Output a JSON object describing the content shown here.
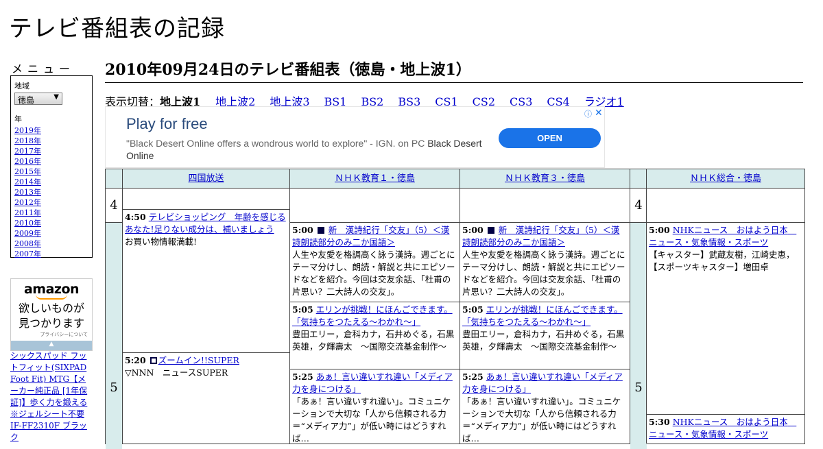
{
  "site_title": "テレビ番組表の記録",
  "sidebar": {
    "menu_title": "メニュー",
    "region_label": "地域",
    "region_value": "徳島",
    "year_label": "年",
    "years": [
      "2019年",
      "2018年",
      "2017年",
      "2016年",
      "2015年",
      "2014年",
      "2013年",
      "2012年",
      "2011年",
      "2010年",
      "2009年",
      "2008年",
      "2007年"
    ],
    "ad": {
      "logo": "amazon",
      "line1": "欲しいものが",
      "line2": "見つかります",
      "privacy": "プライバシーについて"
    },
    "product_link": "シックスパッド フットフィット(SIXPAD Foot Fit) MTG【メーカー純正品 [1年保証]】歩く力を鍛える ※ジェルシート不要 IF-FF2310F ブラック"
  },
  "page_title": "2010年09月24日のテレビ番組表（徳島・地上波1）",
  "switch": {
    "label": "表示切替：",
    "current": "地上波1",
    "links": [
      "地上波2",
      "地上波3",
      "BS1",
      "BS2",
      "BS3",
      "CS1",
      "CS2",
      "CS3",
      "CS4",
      "ラジオ1"
    ]
  },
  "banner": {
    "headline": "Play for free",
    "text": "\"Black Desert Online offers a wondrous world to explore\" - IGN. on PC",
    "brand": "Black Desert Online",
    "cta": "OPEN"
  },
  "channels": [
    "四国放送",
    "ＮＨＫ教育１・徳島",
    "ＮＨＫ教育３・徳島",
    "ＮＨＫ総合・徳島"
  ],
  "hours": [
    "4",
    "5"
  ],
  "programs": {
    "ch1": [
      {
        "time": "4:50",
        "title": "テレビショッピング　年齢を感じるあなた!足りない成分は、補いましょう",
        "desc": "お買い物情報満載!"
      },
      {
        "time": "5:20",
        "title": "ズームイン!!SUPER",
        "desc": "▽NNN　ニュースSUPER"
      }
    ],
    "ch2": [
      {
        "time": "5:00",
        "title": "新　漢詩紀行「交友」（5）＜漢詩朗読部分のみ二か国語＞",
        "desc": "人生や友愛を格調高く詠う漢詩。週ごとにテーマ分けし、朗読・解説と共にエピソードなどを紹介。今回は交友余話、「杜甫の片思い？二大詩人の交友」。"
      },
      {
        "time": "5:05",
        "title": "エリンが挑戦！にほんごできます。「気持ちをつたえる～わかれ～」",
        "desc": "豊田エリー，倉科カナ，石井めぐる，石黒英雄，夕輝壽太　～国際交流基金制作～"
      },
      {
        "time": "5:25",
        "title": "あぁ！言い違いすれ違い「メディア力を身につける」",
        "desc": "「あぁ！言い違いすれ違い」。コミュニケーションで大切な「人から信頼される力＝“メディア力”」が低い時にはどうすれば…"
      }
    ],
    "ch3": [
      {
        "time": "5:00",
        "title": "新　漢詩紀行「交友」（5）＜漢詩朗読部分のみ二か国語＞",
        "desc": "人生や友愛を格調高く詠う漢詩。週ごとにテーマ分けし、朗読・解説と共にエピソードなどを紹介。今回は交友余話、「杜甫の片思い？二大詩人の交友」。"
      },
      {
        "time": "5:05",
        "title": "エリンが挑戦！にほんごできます。「気持ちをつたえる～わかれ～」",
        "desc": "豊田エリー，倉科カナ，石井めぐる，石黒英雄，夕輝壽太　～国際交流基金制作～"
      },
      {
        "time": "5:25",
        "title": "あぁ！言い違いすれ違い「メディア力を身につける」",
        "desc": "「あぁ！言い違いすれ違い」。コミュニケーションで大切な「人から信頼される力＝“メディア力”」が低い時にはどうすれば…"
      }
    ],
    "ch4": [
      {
        "time": "5:00",
        "title": "NHKニュース　おはよう日本　ニュース・気象情報・スポーツ",
        "desc": "【キャスター】武蔵友樹，江崎史恵，【スポーツキャスター】増田卓"
      },
      {
        "time": "5:30",
        "title": "NHKニュース　おはよう日本　ニュース・気象情報・スポーツ",
        "desc": ""
      }
    ]
  }
}
